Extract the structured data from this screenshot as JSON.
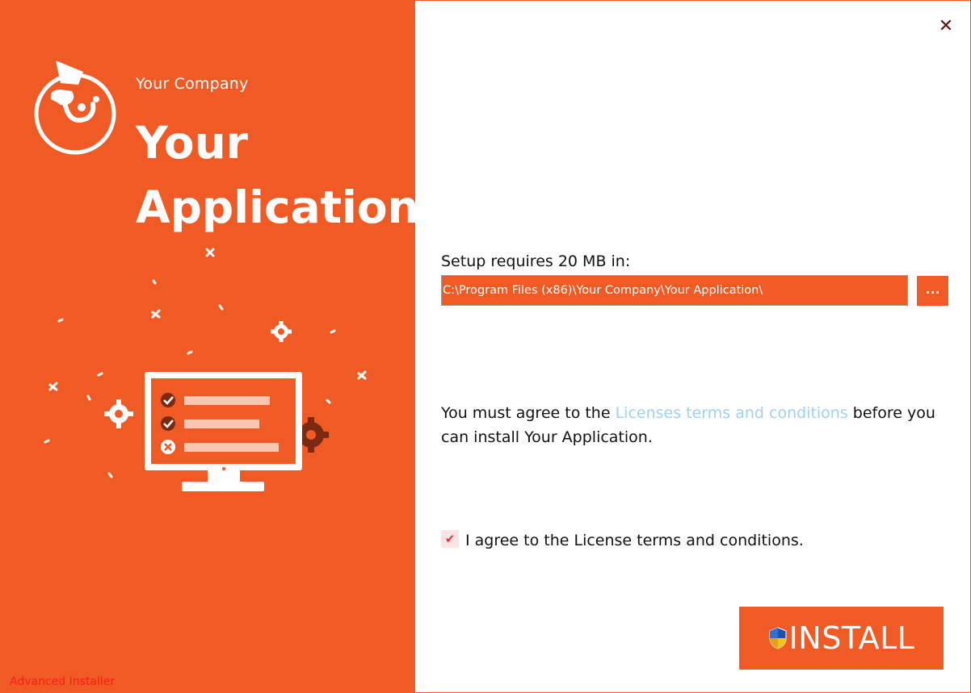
{
  "sidebar": {
    "company_name": "Your Company",
    "app_title": "Your Application",
    "footer_brand": "Advanced Installer"
  },
  "window": {
    "close_glyph": "✕"
  },
  "install_path": {
    "label": "Setup requires 20 MB in:",
    "value": "C:\\Program Files (x86)\\Your Company\\Your Application\\",
    "browse_label": "..."
  },
  "license": {
    "text_before": "You must agree to the ",
    "link_text": "Licenses terms and conditions",
    "text_after": " before you can install Your Application."
  },
  "agree_checkbox": {
    "label": "I agree to the License terms and conditions.",
    "checked": true,
    "check_glyph": "✔"
  },
  "install_button": {
    "label": "INSTALL",
    "icon": "uac-shield-icon"
  },
  "colors": {
    "brand_orange": "#f05a24",
    "link": "#9fd0ee",
    "footer_brand": "#ff1b1b"
  }
}
